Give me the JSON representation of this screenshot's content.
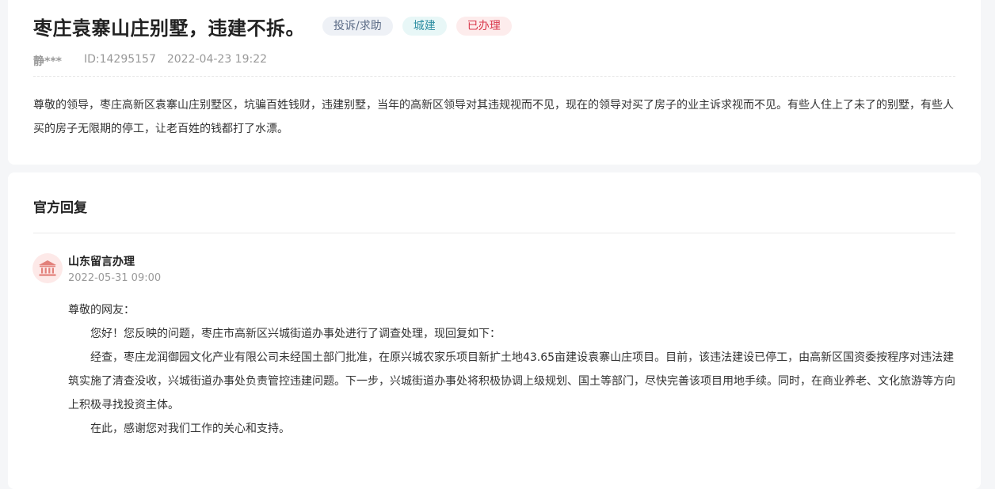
{
  "post": {
    "title": "枣庄袁寨山庄别墅，违建不拆。",
    "tags": {
      "type": "投诉/求助",
      "category": "城建",
      "status": "已办理"
    },
    "author": "静***",
    "id": "ID:14295157",
    "date": "2022-04-23 19:22",
    "content": "尊敬的领导，枣庄高新区袁寨山庄别墅区，坑骗百姓钱财，违建别墅，当年的高新区领导对其违规视而不见，现在的领导对买了房子的业主诉求视而不见。有些人住上了未了的别墅，有些人买的房子无限期的停工，让老百姓的钱都打了水漂。"
  },
  "reply": {
    "section_title": "官方回复",
    "org": "山东留言办理",
    "time": "2022-05-31 09:00",
    "greeting": "尊敬的网友：",
    "paragraphs": [
      "您好！您反映的问题，枣庄市高新区兴城街道办事处进行了调查处理，现回复如下：",
      "经查，枣庄龙润御园文化产业有限公司未经国土部门批准，在原兴城农家乐项目新扩土地43.65亩建设袁寨山庄项目。目前，该违法建设已停工，由高新区国资委按程序对违法建筑实施了清查没收，兴城街道办事处负责管控违建问题。下一步，兴城街道办事处将积极协调上级规划、国土等部门，尽快完善该项目用地手续。同时，在商业养老、文化旅游等方向上积极寻找投资主体。",
      "在此，感谢您对我们工作的关心和支持。"
    ]
  },
  "colors": {
    "status_red": "#d9364a",
    "category_teal": "#2f8fa3",
    "avatar_icon": "#e2807a"
  },
  "icons": {
    "avatar": "government-building-icon"
  }
}
